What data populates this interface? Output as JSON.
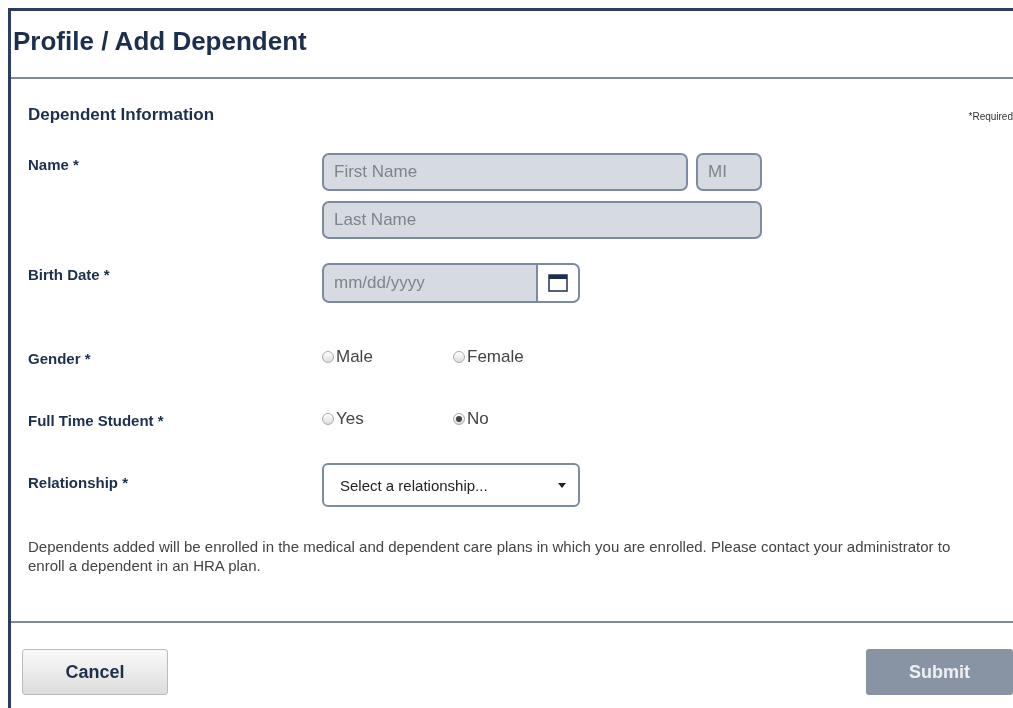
{
  "title": "Profile / Add Dependent",
  "section": {
    "heading": "Dependent Information",
    "required_note": "*Required"
  },
  "name": {
    "label": "Name *",
    "first": {
      "placeholder": "First Name"
    },
    "mi": {
      "placeholder": "MI"
    },
    "last": {
      "placeholder": "Last Name"
    }
  },
  "birth_date": {
    "label": "Birth Date *",
    "placeholder": "mm/dd/yyyy"
  },
  "radio_groups": [
    {
      "label": "Gender *",
      "options": [
        {
          "label": "Male",
          "selected": false
        },
        {
          "label": "Female",
          "selected": false
        }
      ]
    },
    {
      "label": "Full Time Student *",
      "options": [
        {
          "label": "Yes",
          "selected": false
        },
        {
          "label": "No",
          "selected": true
        }
      ]
    }
  ],
  "relationship": {
    "label": "Relationship *",
    "value": "Select a relationship..."
  },
  "notice": "Dependents added will be enrolled in the medical and dependent care plans in which you are enrolled. Please contact your administrator to enroll a dependent in an HRA plan.",
  "buttons": [
    {
      "label": "Cancel",
      "kind": "secondary",
      "disabled": false
    },
    {
      "label": "Submit",
      "kind": "primary",
      "disabled": true
    }
  ]
}
